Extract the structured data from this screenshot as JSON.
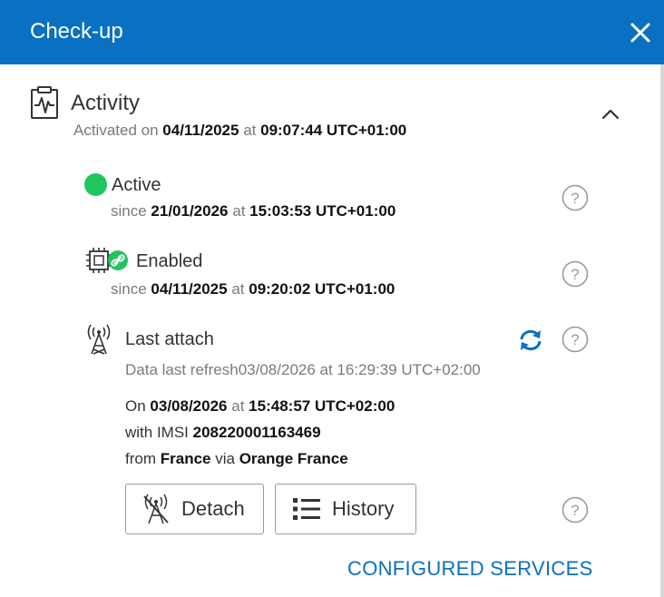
{
  "header": {
    "title": "Check-up"
  },
  "activity": {
    "title": "Activity",
    "activated_prefix": "Activated on",
    "activated_date": "04/11/2025",
    "at": "at",
    "activated_time": "09:07:44 UTC+01:00"
  },
  "status": {
    "label": "Active",
    "since_prefix": "since",
    "date": "21/01/2026",
    "at": "at",
    "time": "15:03:53 UTC+01:00",
    "color": "#21c55d"
  },
  "sim": {
    "label": "Enabled",
    "since_prefix": "since",
    "date": "04/11/2025",
    "at": "at",
    "time": "09:20:02 UTC+01:00"
  },
  "attach": {
    "title": "Last attach",
    "refresh_text": "Data last refresh03/08/2026 at 16:29:39 UTC+02:00",
    "on_prefix": "On",
    "on_date": "03/08/2026",
    "at": "at",
    "on_time": "15:48:57 UTC+02:00",
    "imsi_prefix": "with IMSI",
    "imsi": "208220001163469",
    "from_prefix": "from",
    "country": "France",
    "via": "via",
    "operator": "Orange France"
  },
  "buttons": {
    "detach": "Detach",
    "history": "History"
  },
  "footer": {
    "configured_services": "CONFIGURED SERVICES"
  },
  "colors": {
    "header_bg": "#0a70c2",
    "accent": "#0a70c2",
    "status_green": "#21c55d"
  }
}
